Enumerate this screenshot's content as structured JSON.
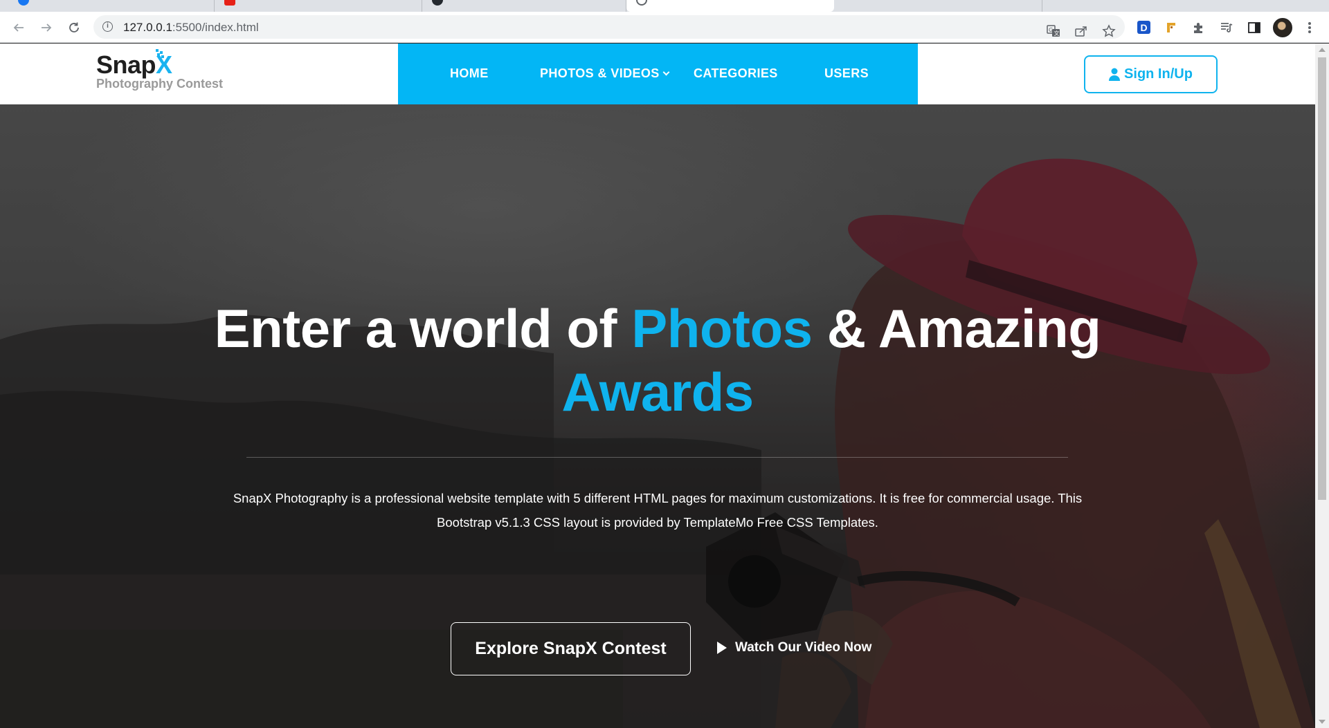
{
  "browser": {
    "url_host": "127.0.0.1",
    "url_path": ":5500/index.html",
    "ext_d_label": "D"
  },
  "site": {
    "brand": {
      "name_main": "Snap",
      "name_accent": "X",
      "tagline": "Photography Contest"
    },
    "nav": [
      {
        "label": "HOME"
      },
      {
        "label": "PHOTOS & VIDEOS"
      },
      {
        "label": "CATEGORIES"
      },
      {
        "label": "USERS"
      }
    ],
    "signin_label": "Sign In/Up"
  },
  "hero": {
    "title_part1": "Enter a world of ",
    "title_accent1": "Photos",
    "title_part2": " & Amazing",
    "title_accent2": "Awards",
    "description": "SnapX Photography is a professional website template with 5 different HTML pages for maximum customizations. It is free for commercial usage. This Bootstrap v5.1.3 CSS layout is provided by TemplateMo Free CSS Templates.",
    "explore_label": "Explore SnapX Contest",
    "watch_label": "Watch Our Video Now"
  },
  "colors": {
    "accent": "#0fb3ee",
    "nav_bg": "#03b6f5"
  }
}
